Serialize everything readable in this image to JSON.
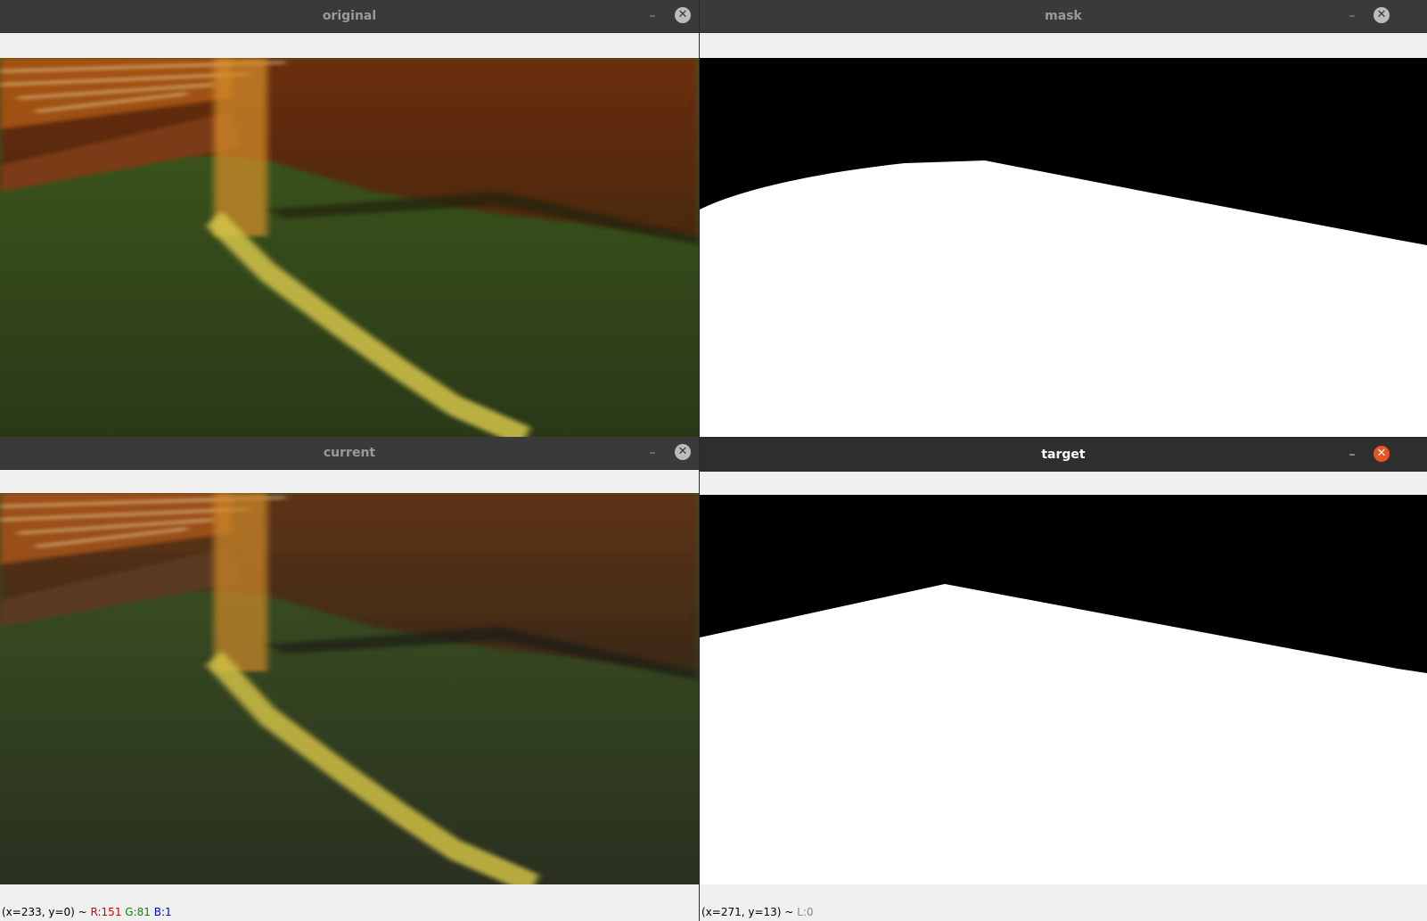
{
  "windows": {
    "original": {
      "title": "original",
      "minimize": "–",
      "close": "✕"
    },
    "mask": {
      "title": "mask",
      "minimize": "–",
      "close": "✕"
    },
    "current": {
      "title": "current",
      "minimize": "–",
      "close": "✕",
      "status": {
        "coords": "(x=233, y=0) ~ ",
        "r": "R:151",
        "g": "G:81",
        "b": "B:1"
      }
    },
    "target": {
      "title": "target",
      "minimize": "–",
      "close": "✕",
      "status": {
        "coords": "(x=271, y=13) ~ ",
        "l": "L:0"
      }
    }
  },
  "colors": {
    "titlebar": "#3a3a3a",
    "titlebar_active": "#2f2f2f",
    "close_active": "#e95420",
    "status_r": "#d00000",
    "status_g": "#008a00",
    "status_b": "#0000d0"
  }
}
